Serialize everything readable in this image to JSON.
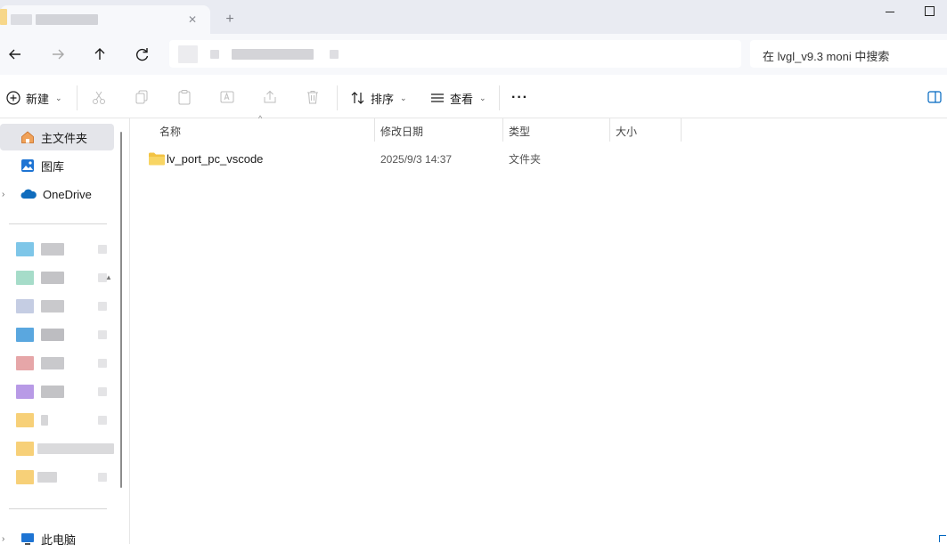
{
  "toolbar": {
    "new_label": "新建",
    "sort_label": "排序",
    "view_label": "查看",
    "more_label": "···"
  },
  "search": {
    "text": "在 lvgl_v9.3 moni 中搜索"
  },
  "sidebar": {
    "items": [
      {
        "label": "主文件夹",
        "icon": "home-icon"
      },
      {
        "label": "图库",
        "icon": "gallery-icon"
      },
      {
        "label": "OneDrive",
        "icon": "cloud-icon"
      },
      {
        "label": "此电脑",
        "icon": "pc-icon"
      }
    ]
  },
  "file_list": {
    "columns": [
      "名称",
      "修改日期",
      "类型",
      "大小"
    ],
    "rows": [
      {
        "name": "lv_port_pc_vscode",
        "modified": "2025/9/3 14:37",
        "type": "文件夹",
        "size": ""
      }
    ]
  },
  "colors": {
    "accent": "#0067c0",
    "folder": "#f3c343",
    "selected": "#e4e5ea"
  }
}
